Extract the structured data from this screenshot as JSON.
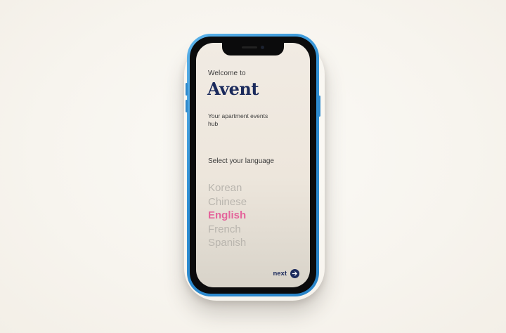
{
  "welcome": {
    "greeting": "Welcome to",
    "brand": "Avent",
    "tagline": "Your apartment events hub"
  },
  "language": {
    "prompt": "Select your language",
    "options": [
      "Korean",
      "Chinese",
      "English",
      "French",
      "Spanish"
    ],
    "selected": "English"
  },
  "actions": {
    "next_label": "next",
    "next_icon": "arrow-right-icon"
  },
  "colors": {
    "brand": "#1b2a5c",
    "selected": "#e4649b",
    "unselected": "#b9b5ae",
    "phone_frame": "#2f8fd4"
  }
}
